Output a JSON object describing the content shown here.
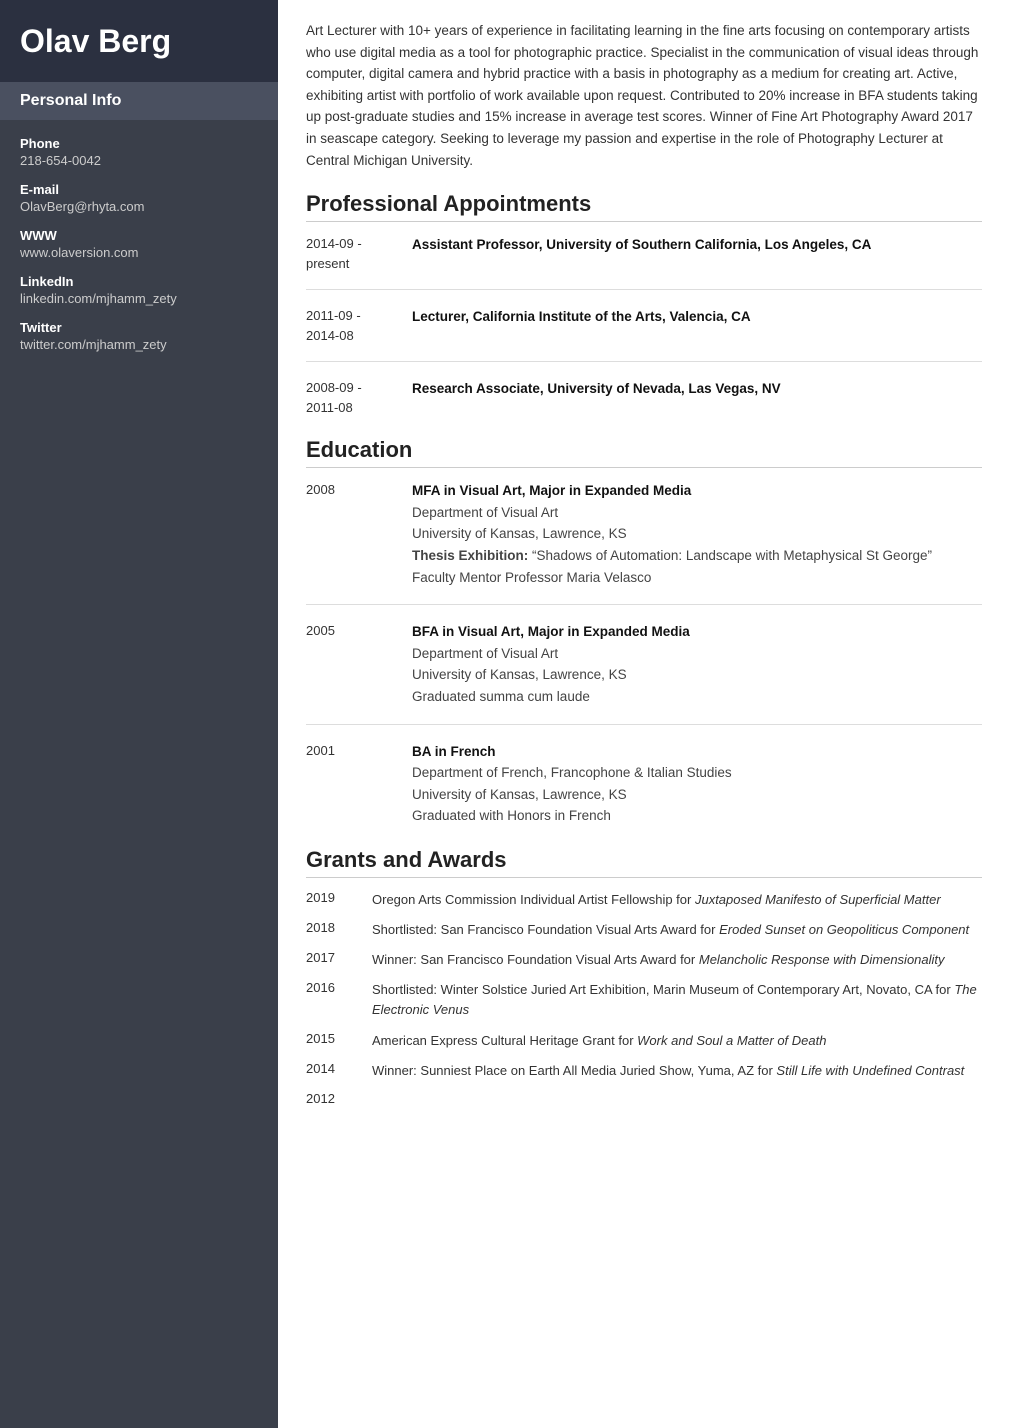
{
  "sidebar": {
    "name": "Olav Berg",
    "personal_info_label": "Personal Info",
    "fields": [
      {
        "label": "Phone",
        "value": "218-654-0042"
      },
      {
        "label": "E-mail",
        "value": "OlavBerg@rhyta.com"
      },
      {
        "label": "WWW",
        "value": "www.olaversion.com"
      },
      {
        "label": "LinkedIn",
        "value": "linkedin.com/mjhamm_zety"
      },
      {
        "label": "Twitter",
        "value": "twitter.com/mjhamm_zety"
      }
    ]
  },
  "main": {
    "summary": "Art Lecturer with 10+ years of experience in facilitating learning in the fine arts focusing on contemporary artists who use digital media as a tool for photographic practice. Specialist in the communication of visual ideas through computer, digital camera and hybrid practice with a basis in photography as a medium for creating art. Active, exhibiting artist with portfolio of work available upon request. Contributed to 20% increase in BFA students taking up post-graduate studies and 15% increase in average test scores. Winner of Fine Art Photography Award 2017 in seascape category. Seeking to leverage my passion and expertise in the role of Photography Lecturer at Central Michigan University.",
    "sections": {
      "appointments_title": "Professional Appointments",
      "education_title": "Education",
      "grants_title": "Grants and Awards"
    },
    "appointments": [
      {
        "date": "2014-09 - present",
        "title": "Assistant Professor, University of Southern California, Los Angeles, CA"
      },
      {
        "date": "2011-09 - 2014-08",
        "title": "Lecturer, California Institute of the Arts, Valencia, CA"
      },
      {
        "date": "2008-09 - 2011-08",
        "title": "Research Associate, University of Nevada, Las Vegas, NV"
      }
    ],
    "education": [
      {
        "year": "2008",
        "degree": "MFA in Visual Art, Major in Expanded Media",
        "lines": [
          "Department of Visual Art",
          "University of Kansas, Lawrence, KS",
          "Thesis Exhibition: “Shadows of Automation: Landscape with Metaphysical St George”",
          "Faculty Mentor Professor Maria Velasco"
        ]
      },
      {
        "year": "2005",
        "degree": "BFA in Visual Art, Major in Expanded Media",
        "lines": [
          "Department of Visual Art",
          "University of Kansas, Lawrence, KS",
          "Graduated summa cum laude"
        ]
      },
      {
        "year": "2001",
        "degree": "BA in French",
        "lines": [
          "Department of French, Francophone & Italian Studies",
          "University of Kansas, Lawrence, KS",
          "Graduated with Honors in French"
        ]
      }
    ],
    "grants": [
      {
        "year": "2019",
        "text": "Oregon Arts Commission Individual Artist Fellowship for ",
        "italic": "Juxtaposed Manifesto of Superficial Matter",
        "rest": ""
      },
      {
        "year": "2018",
        "text": "Shortlisted: San Francisco Foundation Visual Arts Award for ",
        "italic": "Eroded Sunset on Geopoliticus Component",
        "rest": ""
      },
      {
        "year": "2017",
        "text": "Winner: San Francisco Foundation Visual Arts Award for ",
        "italic": "Melancholic Response with Dimensionality",
        "rest": ""
      },
      {
        "year": "2016",
        "text": "Shortlisted: Winter Solstice Juried Art Exhibition, Marin Museum of Contemporary Art, Novato, CA for ",
        "italic": "The Electronic Venus",
        "rest": ""
      },
      {
        "year": "2015",
        "text": "American Express Cultural Heritage Grant for ",
        "italic": "Work and Soul a Matter of Death",
        "rest": ""
      },
      {
        "year": "2014",
        "text": "Winner: Sunniest Place on Earth All Media Juried Show, Yuma, AZ for ",
        "italic": "Still Life with Undefined Contrast",
        "rest": ""
      },
      {
        "year": "2012",
        "text": "",
        "italic": "",
        "rest": ""
      }
    ]
  }
}
